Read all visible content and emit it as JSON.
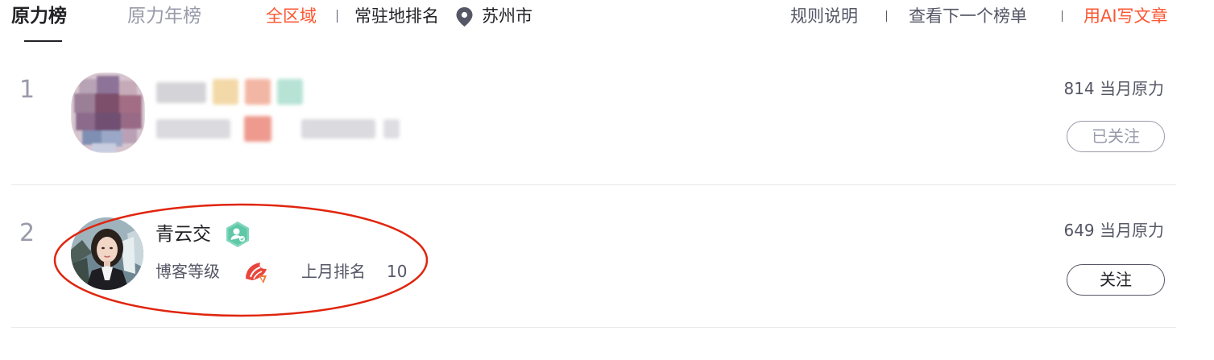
{
  "tabs": {
    "active": "原力榜",
    "year": "原力年榜"
  },
  "filters": {
    "region": "全区域",
    "resident_label": "常驻地排名",
    "city": "苏州市"
  },
  "links": {
    "rules": "规则说明",
    "next_list": "查看下一个榜单",
    "ai_write": "用AI写文章"
  },
  "rows": [
    {
      "rank": "1",
      "power": "814 当月原力",
      "follow_label": "已关注"
    },
    {
      "rank": "2",
      "name": "青云交",
      "level_label": "博客等级",
      "last_month_label": "上月排名",
      "last_month_value": "10",
      "power": "649 当月原力",
      "follow_label": "关注"
    }
  ],
  "colors": {
    "accent": "#fc5531",
    "badge": "#5ec7a6",
    "annotation": "#e0250e"
  }
}
